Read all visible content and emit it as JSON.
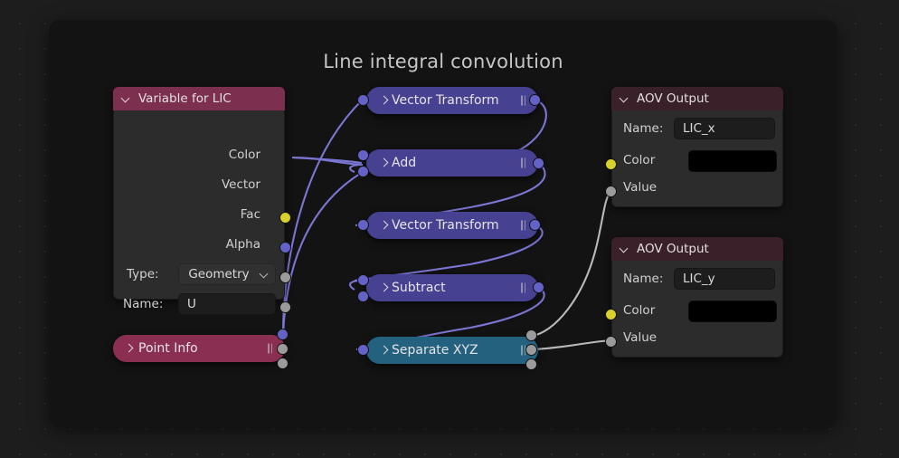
{
  "editor": {
    "title": "Line integral convolution",
    "background": "#1d1d1d",
    "panel_bg": "#131313"
  },
  "colors": {
    "header_pink": "#7d2f4f",
    "header_maroon": "#3a2029",
    "node_purple": "#474191",
    "node_teal": "#24617f",
    "node_pink": "#8a2f52",
    "socket_vector": "#6363c7",
    "socket_color": "#d9d02e",
    "socket_value": "#9b9b9b",
    "link_vector": "#7b76d4",
    "link_value": "#b9b9b9"
  },
  "nodes": {
    "variable_for_lic": {
      "title": "Variable for LIC",
      "outputs": [
        {
          "label": "Color",
          "socket": "color"
        },
        {
          "label": "Vector",
          "socket": "vector"
        },
        {
          "label": "Fac",
          "socket": "value"
        },
        {
          "label": "Alpha",
          "socket": "value"
        }
      ],
      "fields": [
        {
          "label": "Type:",
          "value": "Geometry",
          "kind": "dropdown"
        },
        {
          "label": "Name:",
          "value": "U",
          "kind": "text"
        }
      ]
    },
    "point_info": {
      "title": "Point Info"
    },
    "vector_transform_1": {
      "title": "Vector Transform"
    },
    "add": {
      "title": "Add"
    },
    "vector_transform_2": {
      "title": "Vector Transform"
    },
    "subtract": {
      "title": "Subtract"
    },
    "separate_xyz": {
      "title": "Separate XYZ"
    },
    "aov_output_x": {
      "title": "AOV Output",
      "name_label": "Name:",
      "name_value": "LIC_x",
      "color_label": "Color",
      "color_value": "#000000",
      "value_label": "Value"
    },
    "aov_output_y": {
      "title": "AOV Output",
      "name_label": "Name:",
      "name_value": "LIC_y",
      "color_label": "Color",
      "color_value": "#000000",
      "value_label": "Value"
    }
  }
}
